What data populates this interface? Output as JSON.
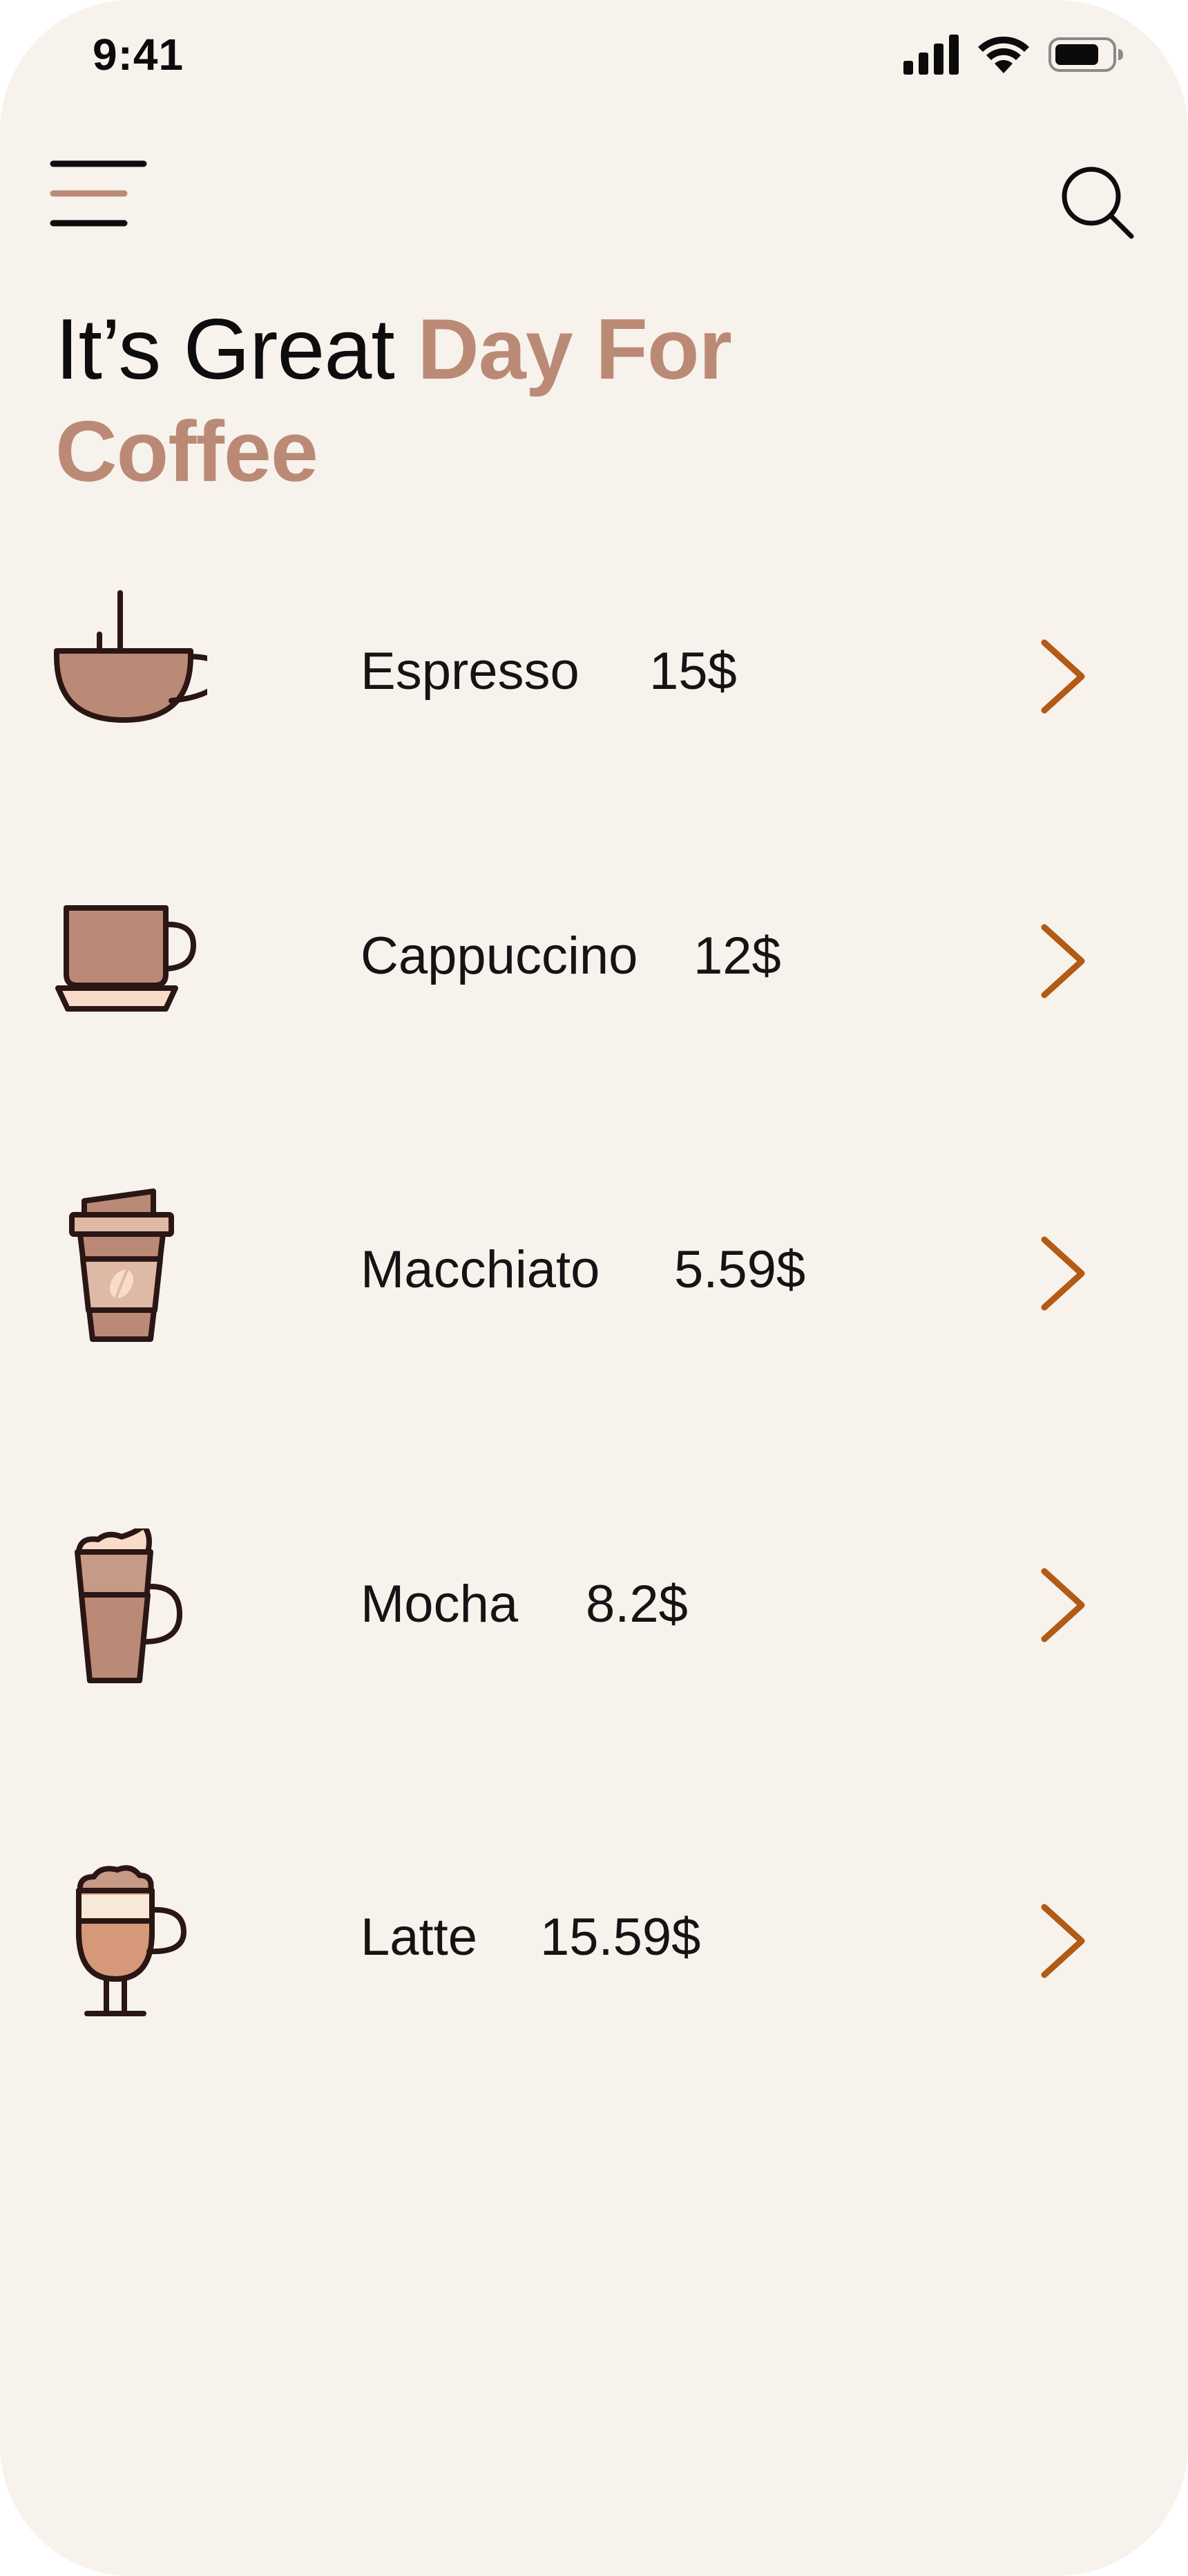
{
  "status_bar": {
    "time": "9:41"
  },
  "header": {
    "menu_icon": "hamburger-menu-icon",
    "search_icon": "search-icon"
  },
  "headline": {
    "prefix": "It’s Great ",
    "accent_line1": "Day For",
    "accent_line2": "Coffee"
  },
  "colors": {
    "background": "#f7f2ec",
    "accent": "#bb8a76",
    "chevron": "#b35a14",
    "cup_fill": "#bb8a76",
    "outline": "#2a1614"
  },
  "menu": [
    {
      "name": "Espresso",
      "price": "15$",
      "icon": "espresso-cup-icon"
    },
    {
      "name": "Cappuccino",
      "price": "12$",
      "icon": "cappuccino-cup-icon"
    },
    {
      "name": "Macchiato",
      "price": "5.59$",
      "icon": "takeaway-cup-icon"
    },
    {
      "name": "Mocha",
      "price": "8.2$",
      "icon": "mocha-glass-icon"
    },
    {
      "name": "Latte",
      "price": "15.59$",
      "icon": "latte-glass-icon"
    }
  ]
}
